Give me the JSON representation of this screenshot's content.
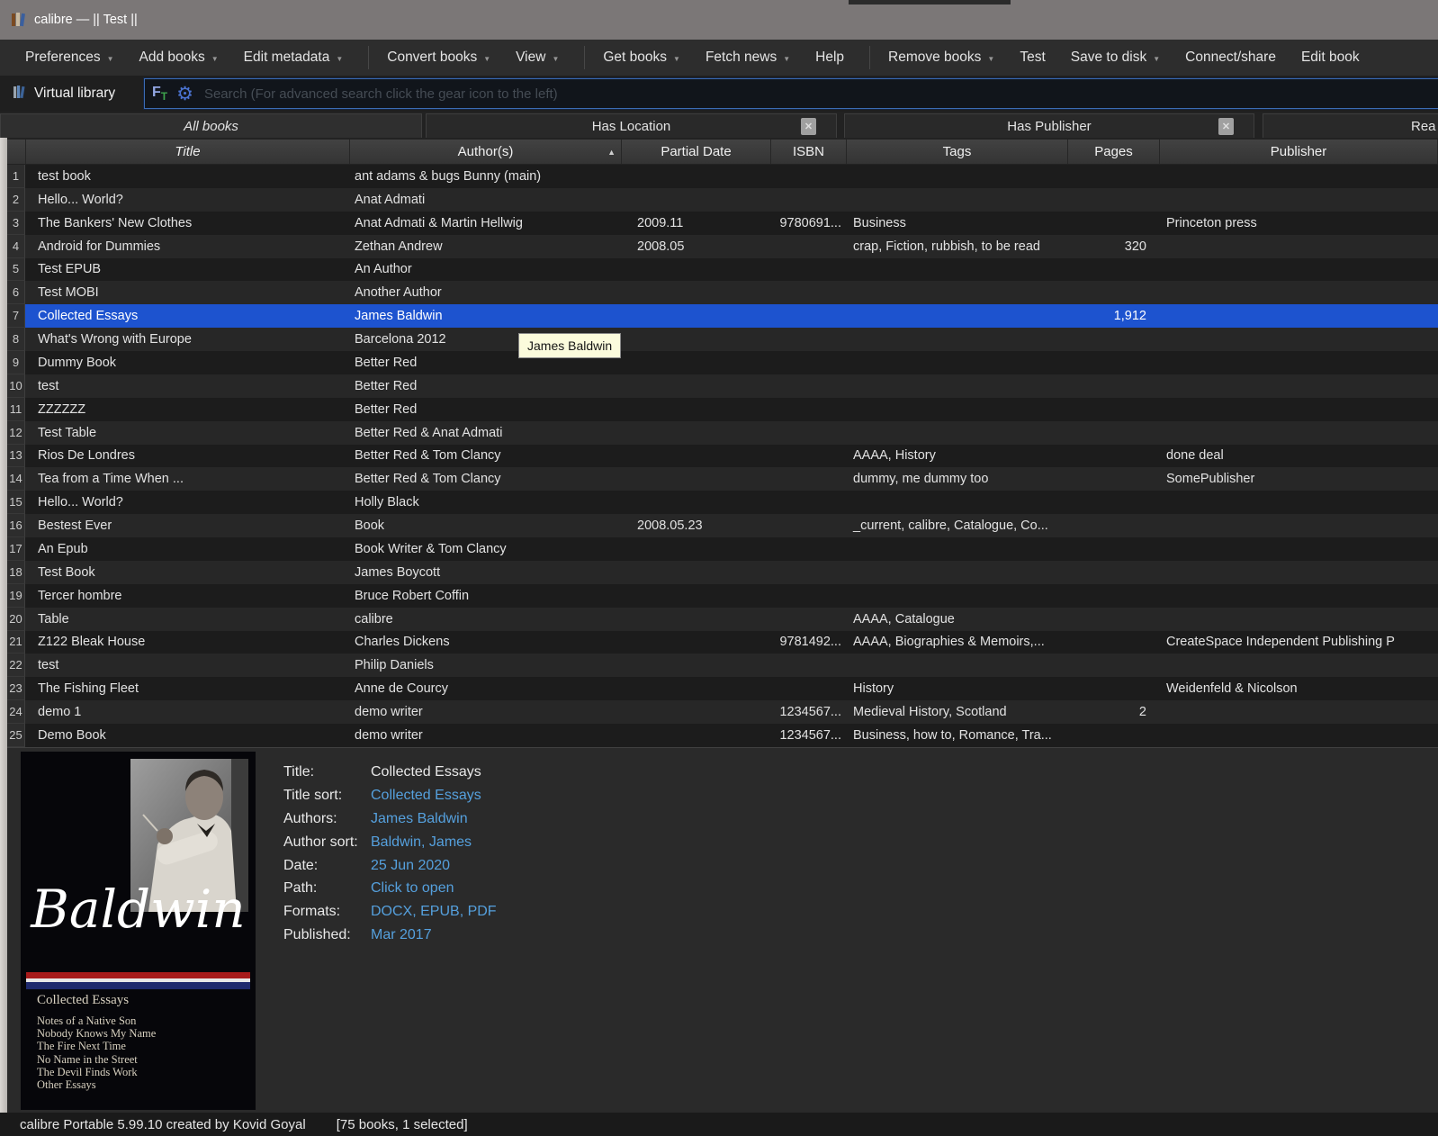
{
  "window": {
    "title": "calibre — || Test ||"
  },
  "toolbar": {
    "items": [
      {
        "label": "Preferences",
        "arrow": true
      },
      {
        "label": "Add books",
        "arrow": true
      },
      {
        "label": "Edit metadata",
        "arrow": true,
        "sep_after": true
      },
      {
        "label": "Convert books",
        "arrow": true
      },
      {
        "label": "View",
        "arrow": true,
        "sep_after": true
      },
      {
        "label": "Get books",
        "arrow": true
      },
      {
        "label": "Fetch news",
        "arrow": true
      },
      {
        "label": "Help",
        "arrow": false,
        "sep_after": true
      },
      {
        "label": "Remove books",
        "arrow": true
      },
      {
        "label": "Test",
        "arrow": false
      },
      {
        "label": "Save to disk",
        "arrow": true
      },
      {
        "label": "Connect/share",
        "arrow": false
      },
      {
        "label": "Edit book",
        "arrow": false
      }
    ]
  },
  "library_bar": {
    "virtual_library_label": "Virtual library",
    "search_placeholder": "Search (For advanced search click the gear icon to the left)"
  },
  "tabs": [
    {
      "label": "All books",
      "selected": true,
      "closable": false
    },
    {
      "label": "Has Location",
      "selected": false,
      "closable": true
    },
    {
      "label": "Has Publisher",
      "selected": false,
      "closable": true
    },
    {
      "label": "Rea",
      "selected": false,
      "closable": false,
      "clipped": true
    }
  ],
  "table": {
    "columns": [
      {
        "label": "Title",
        "italic": true
      },
      {
        "label": "Author(s)",
        "sort": "asc"
      },
      {
        "label": "Partial Date"
      },
      {
        "label": "ISBN"
      },
      {
        "label": "Tags"
      },
      {
        "label": "Pages"
      },
      {
        "label": "Publisher"
      }
    ],
    "rows": [
      {
        "n": 1,
        "title": "test book",
        "authors": "ant adams & bugs Bunny (main)",
        "date": "",
        "isbn": "",
        "tags": "",
        "pages": "",
        "publisher": ""
      },
      {
        "n": 2,
        "title": "Hello... World?",
        "authors": "Anat Admati",
        "date": "",
        "isbn": "",
        "tags": "",
        "pages": "",
        "publisher": ""
      },
      {
        "n": 3,
        "title": "The Bankers' New Clothes",
        "authors": "Anat Admati & Martin Hellwig",
        "date": "2009.11",
        "isbn": "9780691...",
        "tags": "Business",
        "pages": "",
        "publisher": "Princeton press"
      },
      {
        "n": 4,
        "title": "Android for Dummies",
        "authors": "Zethan Andrew",
        "date": "2008.05",
        "isbn": "",
        "tags": "crap, Fiction, rubbish, to be read",
        "pages": "320",
        "publisher": ""
      },
      {
        "n": 5,
        "title": "Test EPUB",
        "authors": "An Author",
        "date": "",
        "isbn": "",
        "tags": "",
        "pages": "",
        "publisher": ""
      },
      {
        "n": 6,
        "title": "Test MOBI",
        "authors": "Another Author",
        "date": "",
        "isbn": "",
        "tags": "",
        "pages": "",
        "publisher": ""
      },
      {
        "n": 7,
        "title": "Collected Essays",
        "authors": "James Baldwin",
        "date": "",
        "isbn": "",
        "tags": "",
        "pages": "1,912",
        "publisher": "",
        "selected": true
      },
      {
        "n": 8,
        "title": "What's Wrong with Europe",
        "authors": "Barcelona 2012",
        "date": "",
        "isbn": "",
        "tags": "",
        "pages": "",
        "publisher": ""
      },
      {
        "n": 9,
        "title": "Dummy Book",
        "authors": "Better Red",
        "date": "",
        "isbn": "",
        "tags": "",
        "pages": "",
        "publisher": ""
      },
      {
        "n": 10,
        "title": "test",
        "authors": "Better Red",
        "date": "",
        "isbn": "",
        "tags": "",
        "pages": "",
        "publisher": ""
      },
      {
        "n": 11,
        "title": "ZZZZZZ",
        "authors": "Better Red",
        "date": "",
        "isbn": "",
        "tags": "",
        "pages": "",
        "publisher": ""
      },
      {
        "n": 12,
        "title": "Test Table",
        "authors": "Better Red & Anat Admati",
        "date": "",
        "isbn": "",
        "tags": "",
        "pages": "",
        "publisher": ""
      },
      {
        "n": 13,
        "title": "Rios De Londres",
        "authors": "Better Red & Tom Clancy",
        "date": "",
        "isbn": "",
        "tags": "AAAA, History",
        "pages": "",
        "publisher": "done deal"
      },
      {
        "n": 14,
        "title": "Tea from a Time When ...",
        "authors": "Better Red & Tom Clancy",
        "date": "",
        "isbn": "",
        "tags": "dummy, me dummy too",
        "pages": "",
        "publisher": "SomePublisher"
      },
      {
        "n": 15,
        "title": "Hello... World?",
        "authors": "Holly Black",
        "date": "",
        "isbn": "",
        "tags": "",
        "pages": "",
        "publisher": ""
      },
      {
        "n": 16,
        "title": "Bestest Ever",
        "authors": "Book",
        "date": "2008.05.23",
        "isbn": "",
        "tags": "_current, calibre, Catalogue, Co...",
        "pages": "",
        "publisher": ""
      },
      {
        "n": 17,
        "title": "An Epub",
        "authors": "Book Writer & Tom Clancy",
        "date": "",
        "isbn": "",
        "tags": "",
        "pages": "",
        "publisher": ""
      },
      {
        "n": 18,
        "title": "Test Book",
        "authors": "James Boycott",
        "date": "",
        "isbn": "",
        "tags": "",
        "pages": "",
        "publisher": ""
      },
      {
        "n": 19,
        "title": "Tercer hombre",
        "authors": "Bruce Robert Coffin",
        "date": "",
        "isbn": "",
        "tags": "",
        "pages": "",
        "publisher": ""
      },
      {
        "n": 20,
        "title": "Table",
        "authors": "calibre",
        "date": "",
        "isbn": "",
        "tags": "AAAA, Catalogue",
        "pages": "",
        "publisher": ""
      },
      {
        "n": 21,
        "title": "Z122 Bleak House",
        "authors": "Charles Dickens",
        "date": "",
        "isbn": "9781492...",
        "tags": "AAAA, Biographies & Memoirs,...",
        "pages": "",
        "publisher": "CreateSpace Independent Publishing P"
      },
      {
        "n": 22,
        "title": "test",
        "authors": "Philip Daniels",
        "date": "",
        "isbn": "",
        "tags": "",
        "pages": "",
        "publisher": ""
      },
      {
        "n": 23,
        "title": "The Fishing Fleet",
        "authors": "Anne de Courcy",
        "date": "",
        "isbn": "",
        "tags": "History",
        "pages": "",
        "publisher": "Weidenfeld & Nicolson"
      },
      {
        "n": 24,
        "title": "demo 1",
        "authors": "demo writer",
        "date": "",
        "isbn": "1234567...",
        "tags": "Medieval History, Scotland",
        "pages": "2",
        "publisher": ""
      },
      {
        "n": 25,
        "title": "Demo Book",
        "authors": "demo writer",
        "date": "",
        "isbn": "1234567...",
        "tags": "Business, how to, Romance, Tra...",
        "pages": "",
        "publisher": ""
      }
    ]
  },
  "tooltip": {
    "text": "James Baldwin"
  },
  "details": {
    "fields": [
      {
        "label": "Title:",
        "value": "Collected Essays",
        "link": false
      },
      {
        "label": "Title sort:",
        "value": "Collected Essays",
        "link": true
      },
      {
        "label": "Authors:",
        "value": "James Baldwin",
        "link": true
      },
      {
        "label": "Author sort:",
        "value": "Baldwin, James",
        "link": true
      },
      {
        "label": "Date:",
        "value": "25 Jun 2020",
        "link": true
      },
      {
        "label": "Path:",
        "value": "Click to open",
        "link": true
      },
      {
        "label": "Formats:",
        "value": "DOCX, EPUB, PDF",
        "link": true
      },
      {
        "label": "Published:",
        "value": "Mar 2017",
        "link": true
      }
    ],
    "cover": {
      "script_text": "Baldwin",
      "series_title": "Collected Essays",
      "works": [
        "Notes of a Native Son",
        "Nobody Knows My Name",
        "The Fire Next Time",
        "No Name in the Street",
        "The Devil Finds Work",
        "Other Essays"
      ]
    }
  },
  "status_bar": {
    "left": "calibre Portable 5.99.10 created by Kovid Goyal",
    "right": "[75 books, 1 selected]"
  },
  "colors": {
    "selection_blue": "#1d53cf",
    "link_blue": "#55a0dd",
    "titlebar_gray": "#7b7777",
    "tooltip_bg": "#fbfbdc"
  }
}
